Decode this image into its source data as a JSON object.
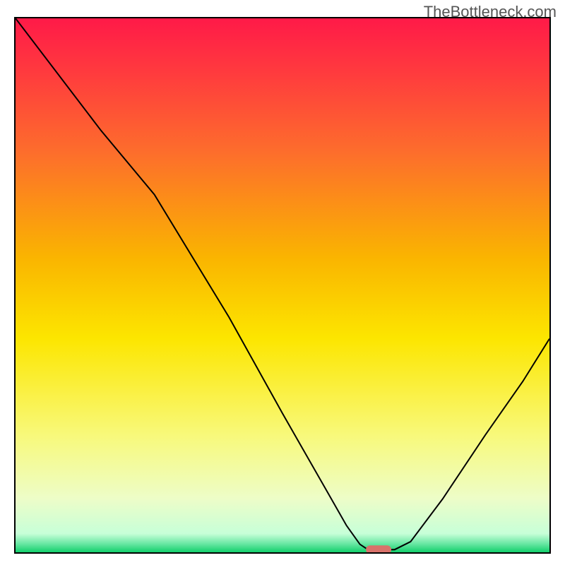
{
  "watermark": "TheBottleneck.com",
  "chart_data": {
    "type": "line",
    "title": "",
    "xlabel": "",
    "ylabel": "",
    "xlim": [
      0,
      100
    ],
    "ylim": [
      0,
      100
    ],
    "gradient_stops": [
      {
        "pos": 0.0,
        "color": "#ff1a48"
      },
      {
        "pos": 0.1,
        "color": "#ff3a3e"
      },
      {
        "pos": 0.25,
        "color": "#fd6d2c"
      },
      {
        "pos": 0.45,
        "color": "#fab500"
      },
      {
        "pos": 0.6,
        "color": "#fce600"
      },
      {
        "pos": 0.78,
        "color": "#f8f97a"
      },
      {
        "pos": 0.9,
        "color": "#edfdc8"
      },
      {
        "pos": 0.965,
        "color": "#c7ffd8"
      },
      {
        "pos": 0.985,
        "color": "#63e6a0"
      },
      {
        "pos": 1.0,
        "color": "#12cf6c"
      }
    ],
    "curve_points": [
      {
        "x": 0,
        "y": 100
      },
      {
        "x": 16,
        "y": 79
      },
      {
        "x": 26,
        "y": 67
      },
      {
        "x": 40,
        "y": 44
      },
      {
        "x": 50,
        "y": 26
      },
      {
        "x": 58,
        "y": 12
      },
      {
        "x": 62,
        "y": 5
      },
      {
        "x": 64.5,
        "y": 1.5
      },
      {
        "x": 66,
        "y": 0.5
      },
      {
        "x": 71,
        "y": 0.5
      },
      {
        "x": 74,
        "y": 2
      },
      {
        "x": 80,
        "y": 10
      },
      {
        "x": 88,
        "y": 22
      },
      {
        "x": 95,
        "y": 32
      },
      {
        "x": 100,
        "y": 40
      }
    ],
    "marker": {
      "x": 68,
      "y": 0.5,
      "color": "#d9726a"
    }
  }
}
